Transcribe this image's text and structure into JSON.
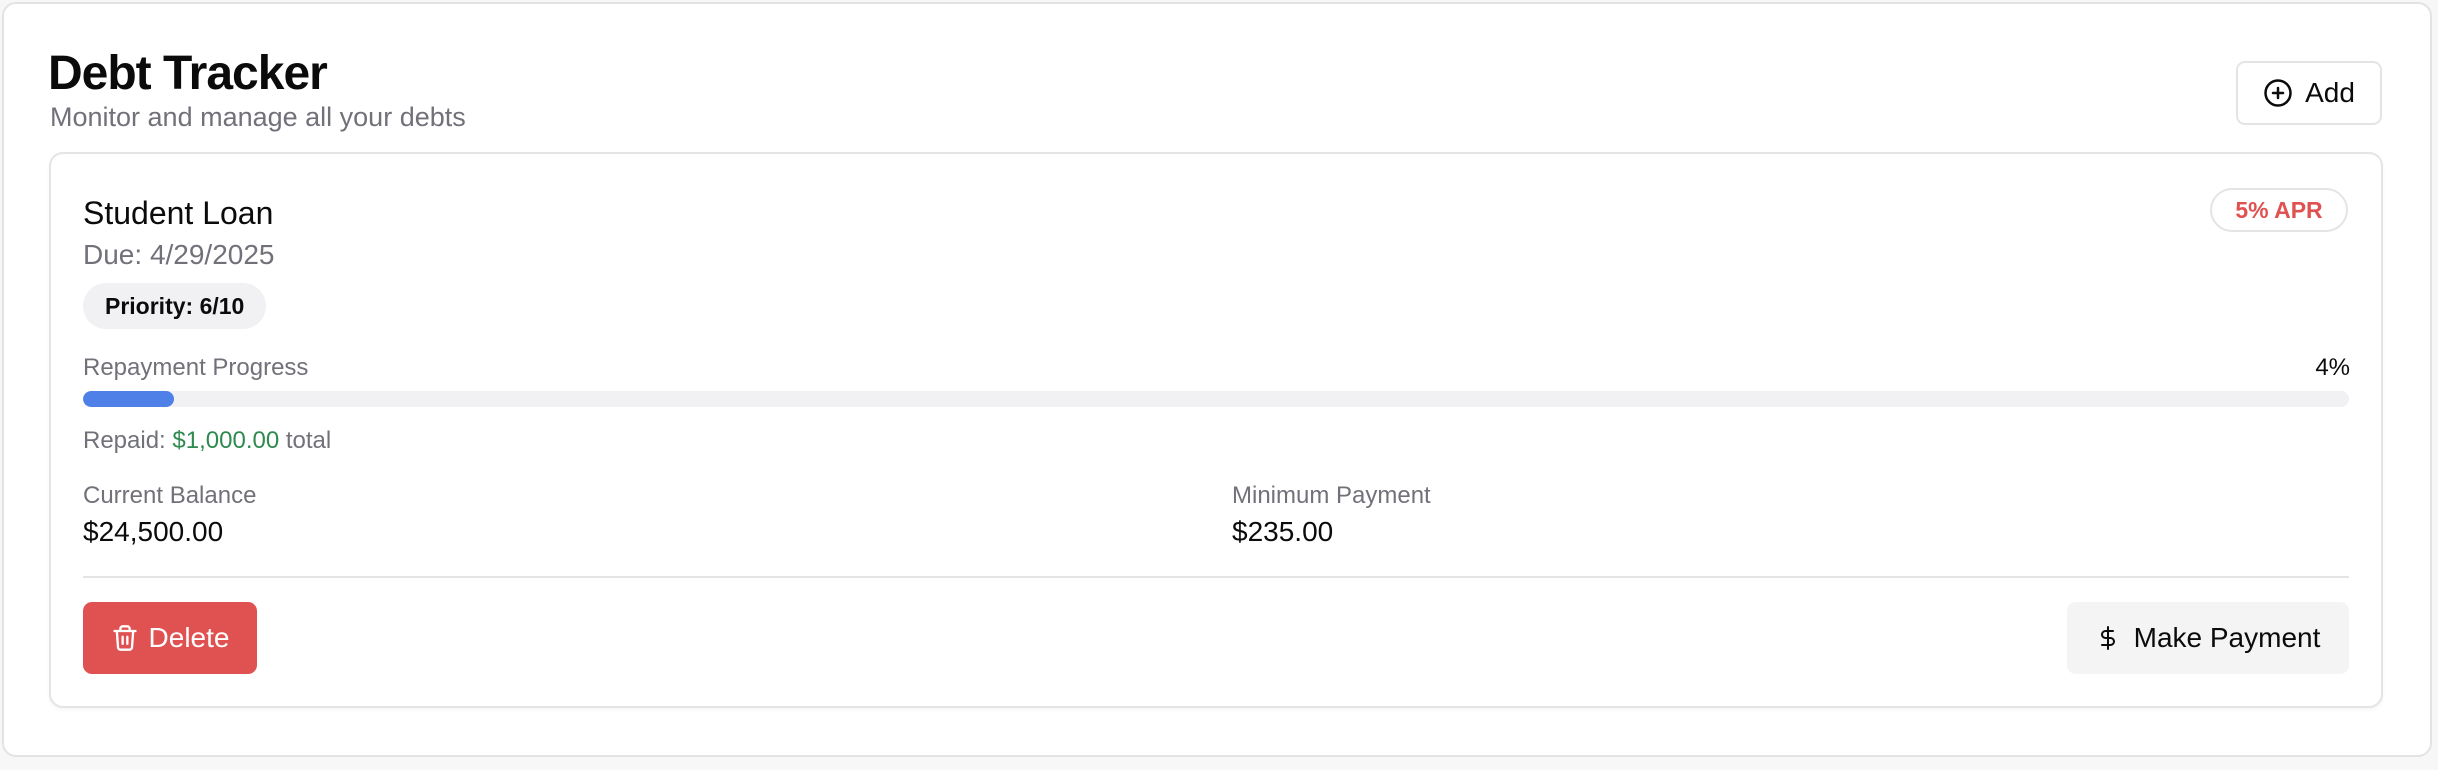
{
  "header": {
    "title": "Debt Tracker",
    "subtitle": "Monitor and manage all your debts",
    "add_label": "Add"
  },
  "debt": {
    "name": "Student Loan",
    "due_prefix": "Due:",
    "due_date": "4/29/2025",
    "priority": "Priority: 6/10",
    "apr": "5% APR",
    "progress_label": "Repayment Progress",
    "progress_percent": "4%",
    "progress_value": 0.04,
    "repaid_prefix": "Repaid:",
    "repaid_amount": "$1,000.00",
    "repaid_suffix": "total",
    "current_balance_label": "Current Balance",
    "current_balance": "$24,500.00",
    "minimum_payment_label": "Minimum Payment",
    "minimum_payment": "$235.00",
    "delete_label": "Delete",
    "pay_label": "Make Payment"
  },
  "icons": {
    "add": "plus-circle-icon",
    "delete": "trash-icon",
    "pay": "dollar-sign-icon"
  },
  "colors": {
    "accent_blue": "#4f80e8",
    "danger_red": "#e05252",
    "success_green": "#2f8a4f",
    "muted_text": "#71717a"
  }
}
